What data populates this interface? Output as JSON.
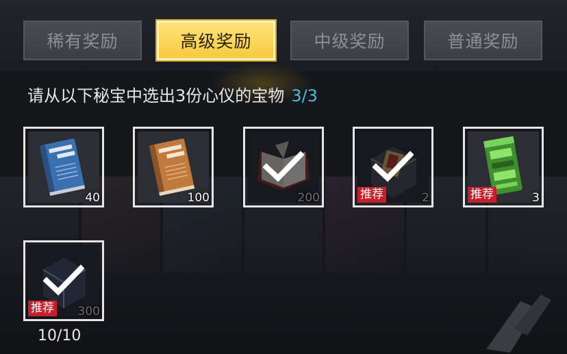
{
  "tabs": [
    {
      "label": "稀有奖励",
      "active": false
    },
    {
      "label": "高级奖励",
      "active": true
    },
    {
      "label": "中级奖励",
      "active": false
    },
    {
      "label": "普通奖励",
      "active": false
    }
  ],
  "instruction": {
    "text": "请从以下秘宝中选出3份心仪的宝物",
    "count": "3/3"
  },
  "items": [
    {
      "icon": "blue-theory-book-icon",
      "quantity": "40",
      "tag": "",
      "selected": false,
      "frame": "red"
    },
    {
      "icon": "orange-theory-book-icon",
      "quantity": "100",
      "tag": "",
      "selected": false,
      "frame": "orange"
    },
    {
      "icon": "red-book-icon",
      "quantity": "200",
      "tag": "",
      "selected": true,
      "frame": "red"
    },
    {
      "icon": "card-box-icon",
      "quantity": "2",
      "tag": "推荐",
      "selected": true,
      "frame": "red"
    },
    {
      "icon": "green-device-icon",
      "quantity": "3",
      "tag": "推荐",
      "selected": false,
      "frame": "yellow"
    },
    {
      "icon": "crystal-cube-icon",
      "quantity": "300",
      "tag": "推荐",
      "selected": true,
      "frame": "orange"
    }
  ],
  "progress": "10/10",
  "colors": {
    "accent": "#f5cb3f",
    "count": "#49b9e6",
    "tag": "#c4202a"
  }
}
